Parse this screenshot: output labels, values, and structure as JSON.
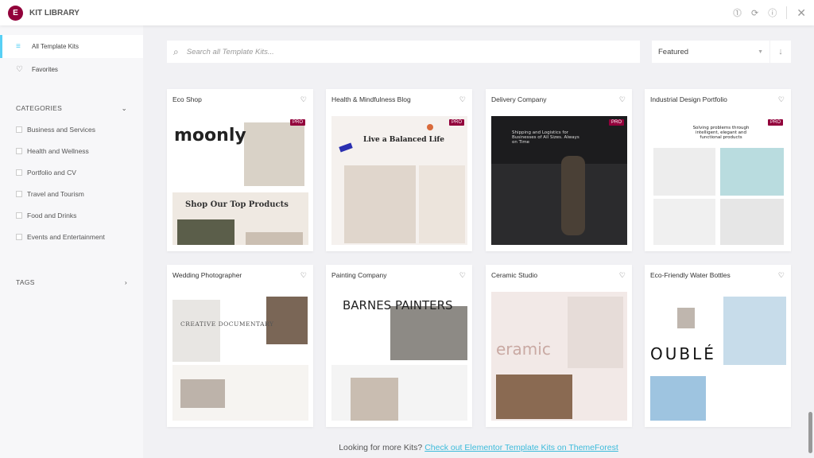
{
  "header": {
    "logo": "E",
    "title": "KIT LIBRARY"
  },
  "sidebar": {
    "nav": [
      {
        "label": "All Template Kits",
        "icon": "filter-icon"
      },
      {
        "label": "Favorites",
        "icon": "heart-icon"
      }
    ],
    "categories_label": "CATEGORIES",
    "categories": [
      "Business and Services",
      "Health and Wellness",
      "Portfolio and CV",
      "Travel and Tourism",
      "Food and Drinks",
      "Events and Entertainment"
    ],
    "tags_label": "TAGS"
  },
  "search": {
    "placeholder": "Search all Template Kits..."
  },
  "sort": {
    "value": "Featured"
  },
  "kits": [
    {
      "name": "Eco Shop",
      "pro": "PRO",
      "preview_text": "moonly",
      "preview_sub": "Shop Our Top Products"
    },
    {
      "name": "Health & Mindfulness Blog",
      "pro": "PRO",
      "preview_text": "Live a Balanced Life",
      "preview_sub": ""
    },
    {
      "name": "Delivery Company",
      "pro": "PRO",
      "preview_text": "Shipping and Logistics for Businesses of All Sizes. Always on Time",
      "preview_sub": ""
    },
    {
      "name": "Industrial Design Portfolio",
      "pro": "PRO",
      "preview_text": "Solving problems through intelligent, elegant and functional products",
      "preview_sub": ""
    },
    {
      "name": "Wedding Photographer",
      "pro": "",
      "preview_text": "CREATIVE DOCUMENTARY",
      "preview_sub": ""
    },
    {
      "name": "Painting Company",
      "pro": "",
      "preview_text": "BARNES PAINTERS",
      "preview_sub": ""
    },
    {
      "name": "Ceramic Studio",
      "pro": "",
      "preview_text": "eramic",
      "preview_sub": ""
    },
    {
      "name": "Eco-Friendly Water Bottles",
      "pro": "",
      "preview_text": "OUBLÉ",
      "preview_sub": ""
    }
  ],
  "footer": {
    "text": "Looking for more Kits?",
    "link": "Check out Elementor Template Kits on ThemeForest"
  },
  "colors": {
    "brand": "#92003b",
    "accent": "#58d0f5",
    "link": "#3dbbdb"
  }
}
